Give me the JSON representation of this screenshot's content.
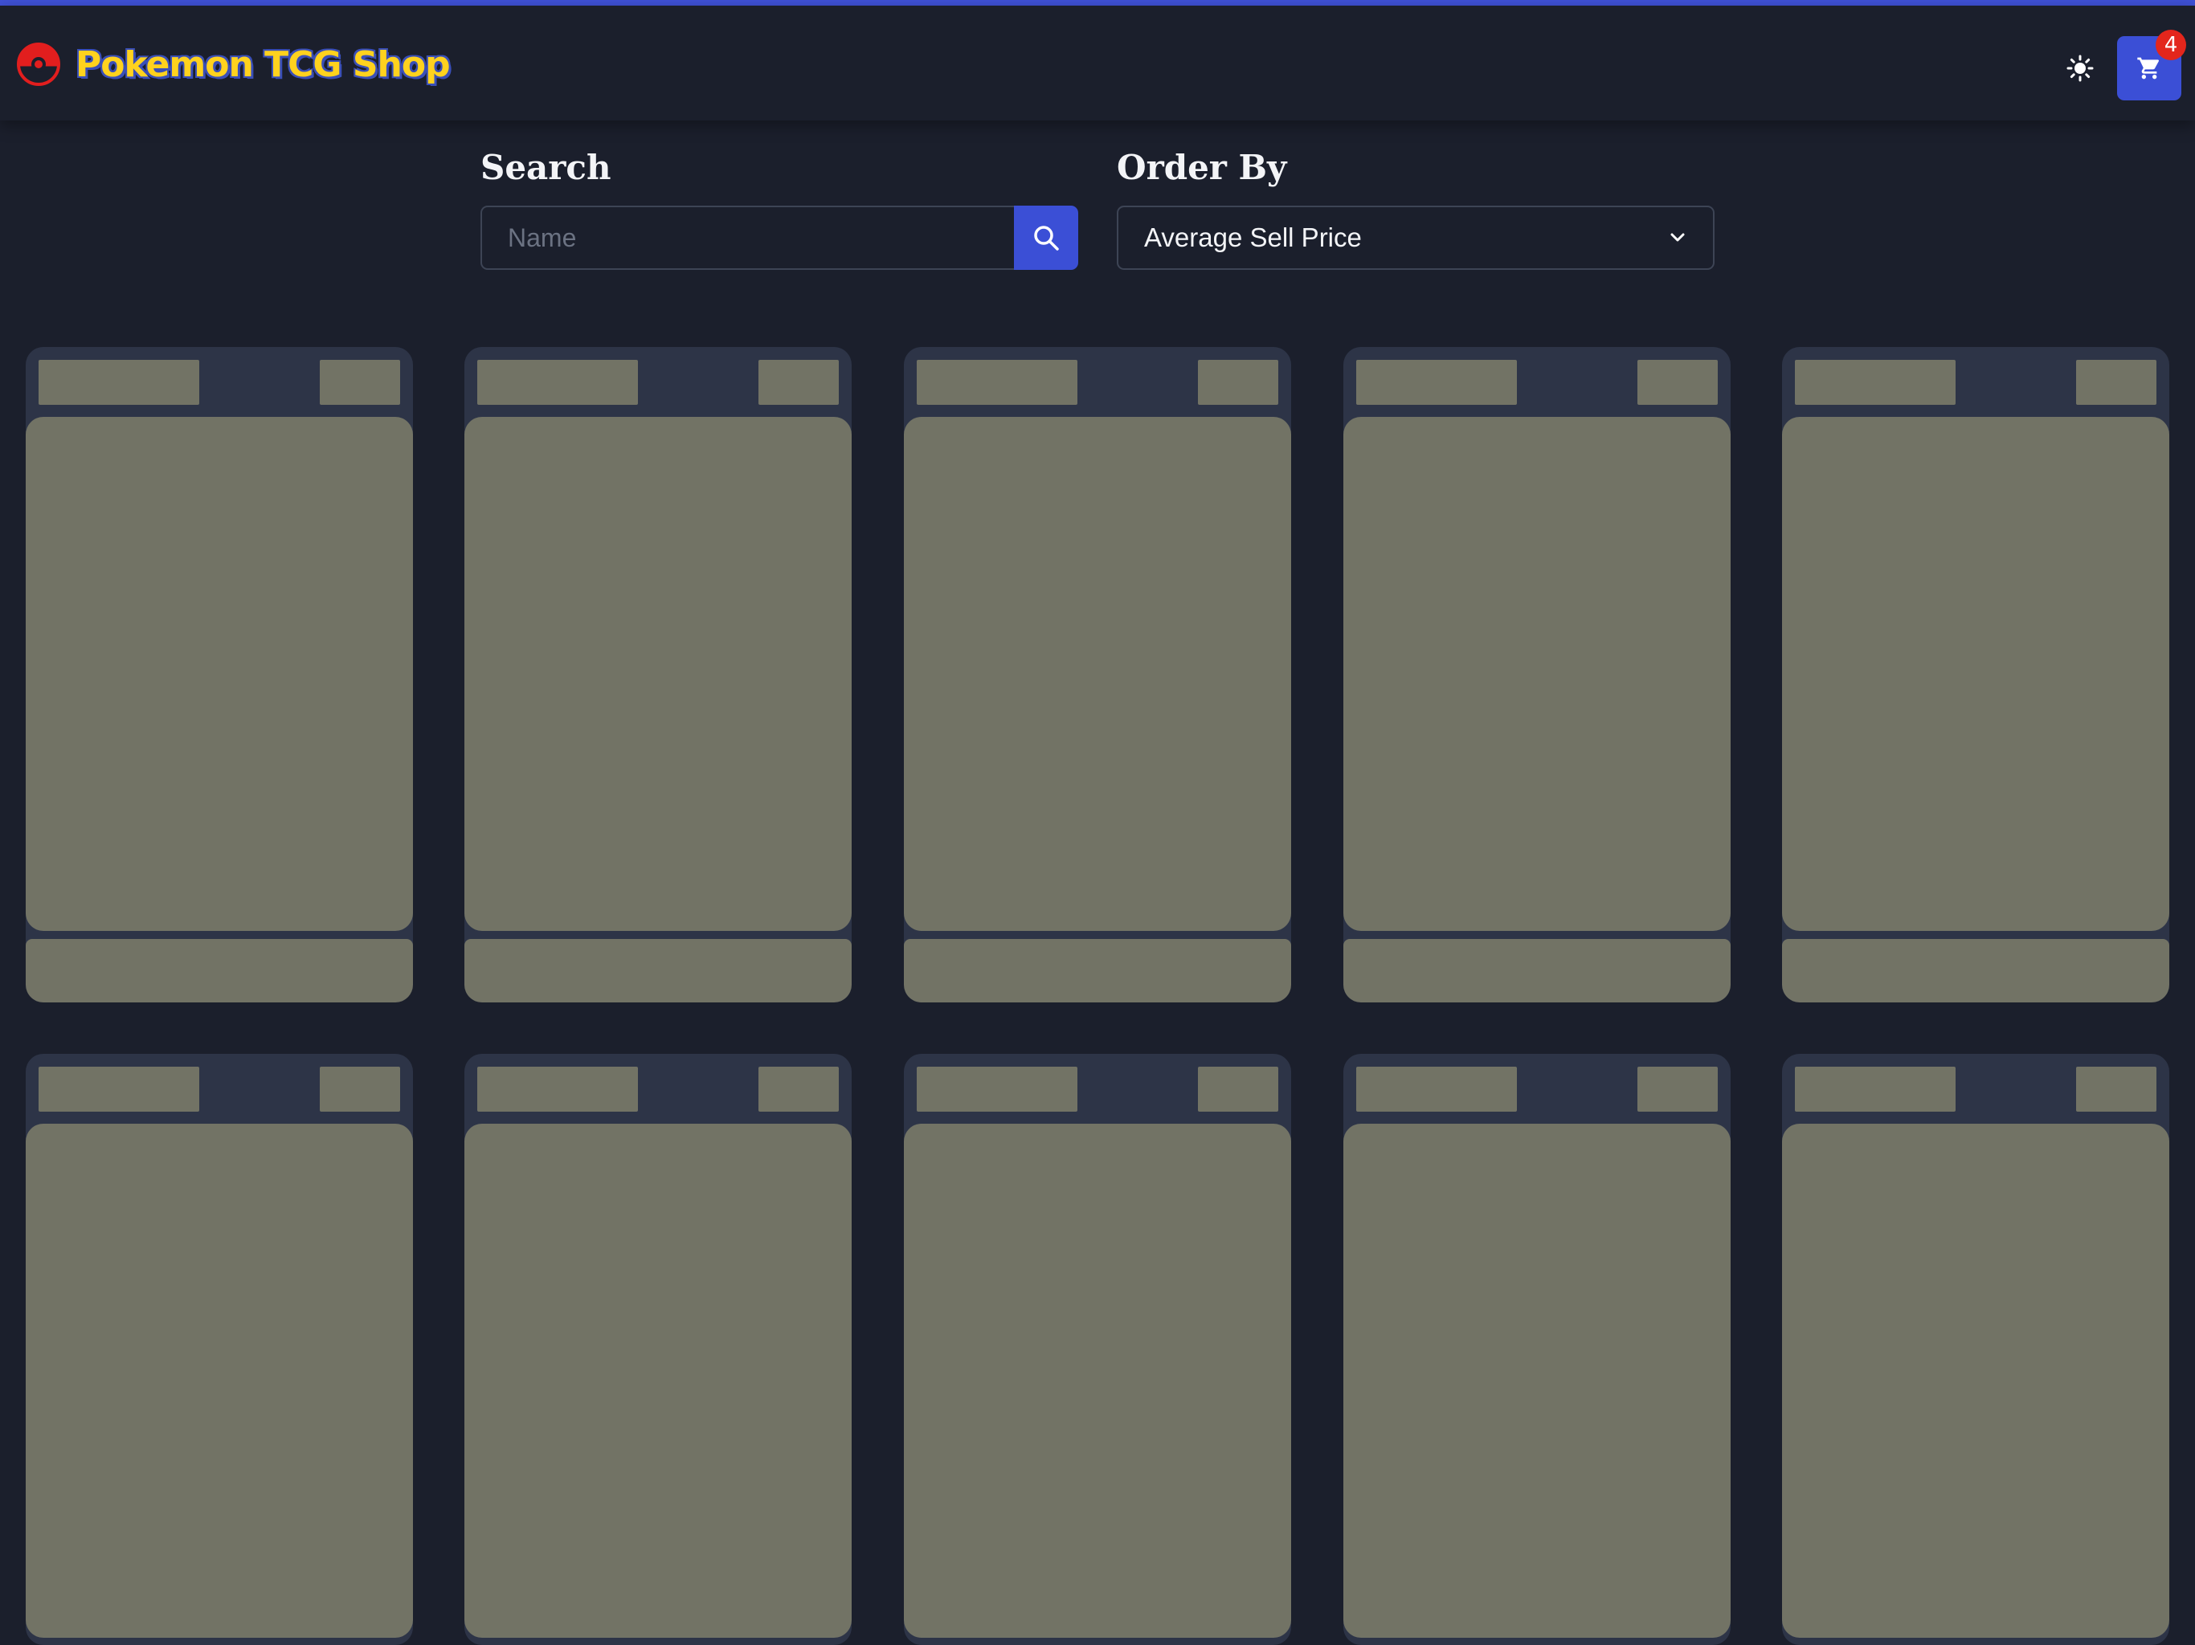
{
  "header": {
    "title": "Pokemon TCG Shop",
    "logo_icon": "pokeball-icon",
    "theme_toggle_icon": "sun-icon",
    "cart_icon": "shopping-cart-icon",
    "cart_count": "4"
  },
  "filters": {
    "search": {
      "label": "Search",
      "placeholder": "Name",
      "value": "",
      "button_icon": "search-icon"
    },
    "order_by": {
      "label": "Order By",
      "selected": "Average Sell Price",
      "icon": "chevron-down-icon"
    }
  },
  "cards": {
    "state": "loading-skeleton",
    "count": 10
  },
  "colors": {
    "background": "#1b1f2c",
    "accent": "#3b4fd6",
    "title": "#ffd21e",
    "badge": "#e3261c",
    "card": "#2d3447",
    "skeleton": "#727365"
  }
}
